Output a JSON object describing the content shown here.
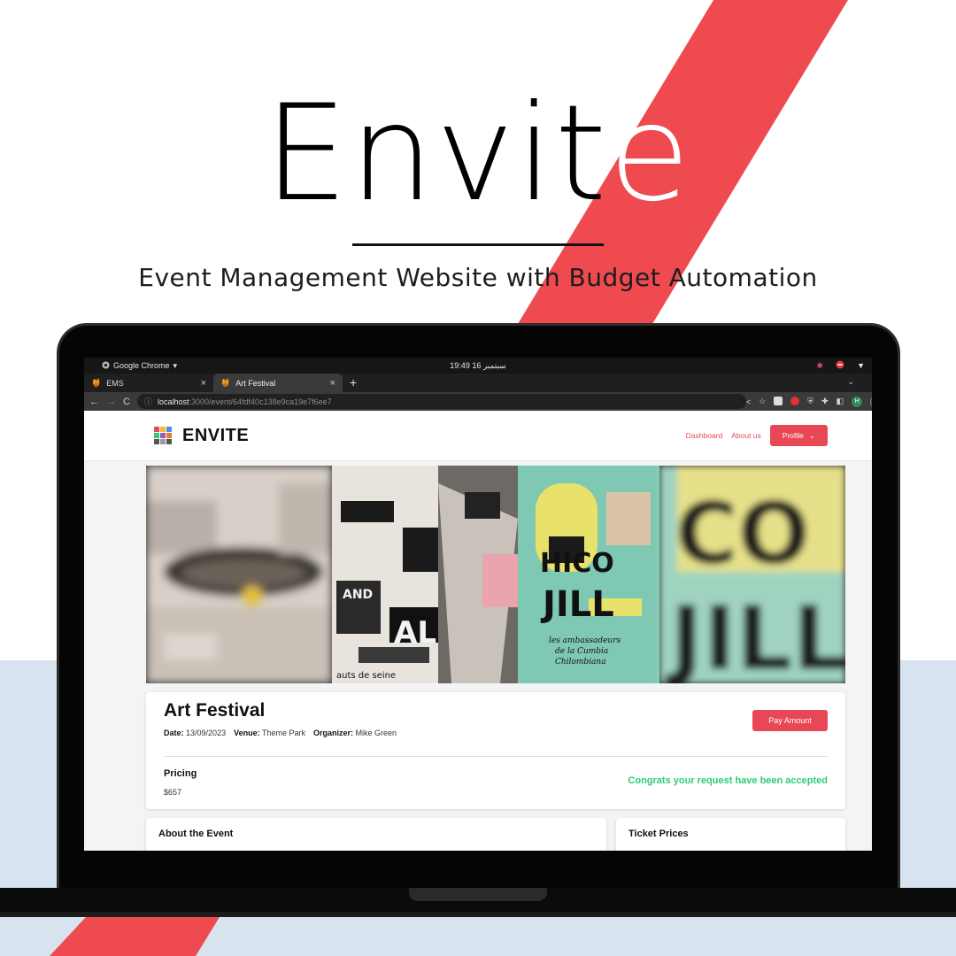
{
  "poster": {
    "title_main": "Envit",
    "title_last": "e",
    "subtitle": "Event Management Website with Budget Automation",
    "accent_color": "#ef4a4f",
    "bottom_color": "#d7e4ef"
  },
  "os_bar": {
    "app_name": "Google Chrome",
    "clock": "19:49  16 سبتمبر",
    "tray_icons": [
      "slack-icon",
      "do-not-disturb-icon",
      "wifi-icon"
    ]
  },
  "browser": {
    "tabs": [
      {
        "icon": "ems-favicon",
        "label": "EMS",
        "active": false
      },
      {
        "icon": "ems-favicon",
        "label": "Art Festival",
        "active": true
      }
    ],
    "new_tab": "+",
    "url_host": "localhost",
    "url_path": ":3000/event/64fdf40c138e9ca19e7f6ee7",
    "profile_initials": [
      "H",
      "U"
    ]
  },
  "site": {
    "brand": "ENVITE",
    "nav": {
      "dashboard": "Dashboard",
      "about": "About us",
      "profile": "Profile"
    }
  },
  "event": {
    "title": "Art Festival",
    "date_label": "Date:",
    "date_value": "13/09/2023",
    "venue_label": "Venue:",
    "venue_value": "Theme Park",
    "organizer_label": "Organizer:",
    "organizer_value": "Mike Green",
    "pay_button": "Pay Amount",
    "pricing_label": "Pricing",
    "pricing_value": "$657",
    "status_text": "Congrats your request have been accepted",
    "status_color": "#2ecc71"
  },
  "sections": {
    "about_title": "About the Event",
    "tickets_title": "Ticket Prices"
  },
  "banner_text": {
    "line1": "CO",
    "line2": "JILL",
    "small1": "les ambassadeurs",
    "small2": "de la Cumbia",
    "small3": "Chilombiana",
    "left1": "AND",
    "left2": "AL",
    "left3": "auts de seine"
  }
}
